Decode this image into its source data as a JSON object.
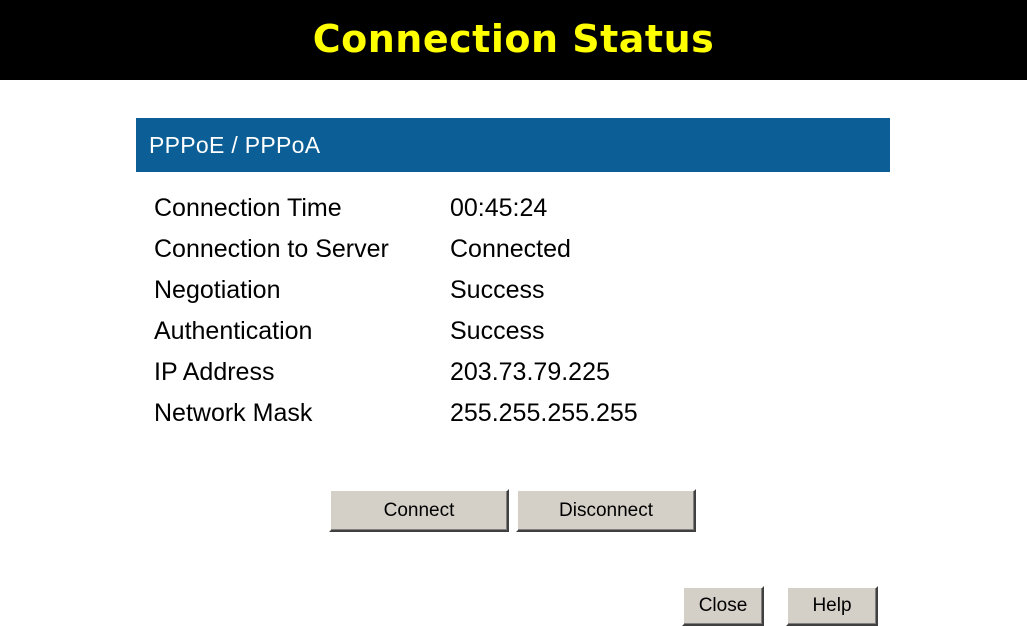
{
  "page": {
    "title": "Connection Status"
  },
  "section": {
    "header": "PPPoE / PPPoA",
    "rows": [
      {
        "label": "Connection Time",
        "value": "00:45:24"
      },
      {
        "label": "Connection to Server",
        "value": "Connected"
      },
      {
        "label": "Negotiation",
        "value": "Success"
      },
      {
        "label": "Authentication",
        "value": "Success"
      },
      {
        "label": "IP Address",
        "value": "203.73.79.225"
      },
      {
        "label": "Network Mask",
        "value": "255.255.255.255"
      }
    ]
  },
  "actions": {
    "connect_label": "Connect",
    "disconnect_label": "Disconnect",
    "close_label": "Close",
    "help_label": "Help"
  },
  "colors": {
    "title_bar_bg": "#000000",
    "title_text": "#ffff00",
    "section_header_bg": "#0b5f96",
    "section_header_text": "#ffffff",
    "button_face": "#d4d0c8"
  }
}
